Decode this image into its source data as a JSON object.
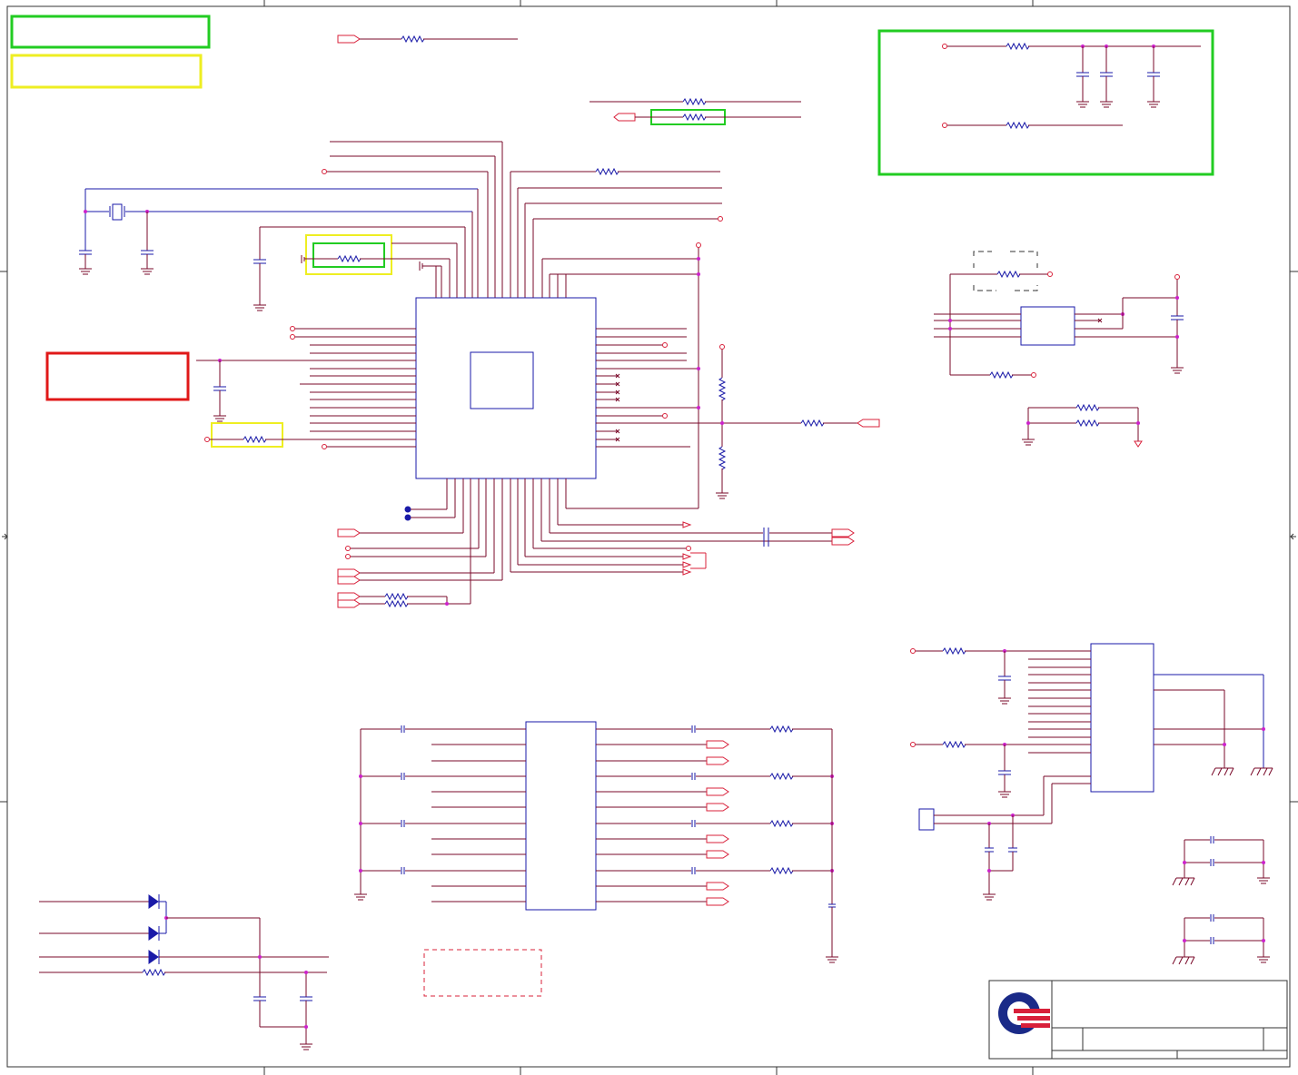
{
  "colors": {
    "wire": "#7a0a2a",
    "component": "#1a1aa8",
    "port": "#d8203a",
    "junction": "#cc22cc",
    "highlight_green": "#22cc22",
    "highlight_yellow": "#eeee22",
    "highlight_red": "#e01818",
    "logo_blue": "#1a2a88",
    "logo_red": "#d8203a"
  },
  "sheet": {
    "logo": "company-logo-icon",
    "title_block_text": ""
  }
}
